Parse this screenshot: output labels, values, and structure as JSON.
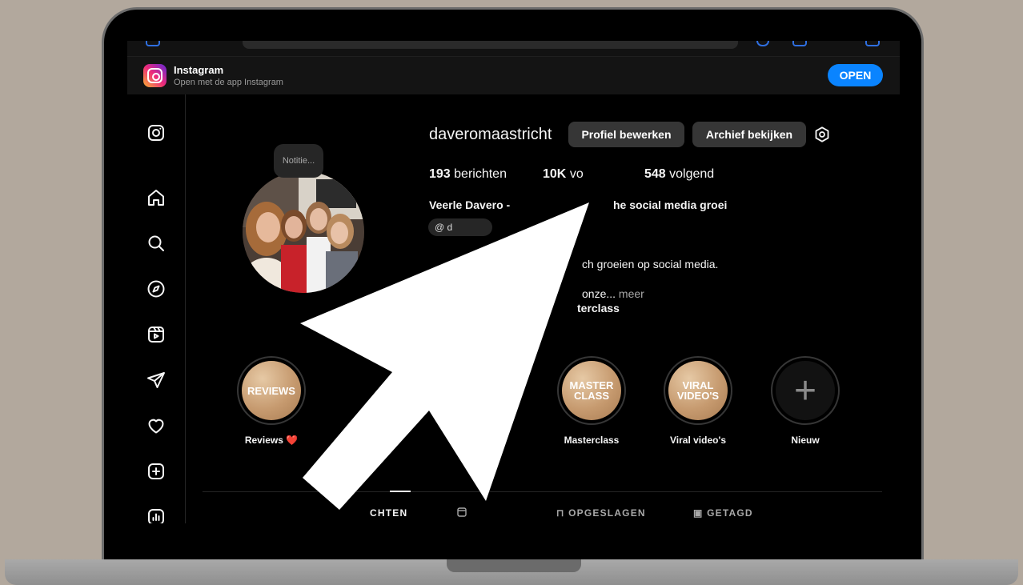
{
  "banner": {
    "app_name": "Instagram",
    "subtitle": "Open met de app Instagram",
    "open_label": "OPEN"
  },
  "profile": {
    "username": "daveromaastricht",
    "edit_label": "Profiel bewerken",
    "archive_label": "Archief bekijken",
    "note_text": "Notitie...",
    "stats": {
      "posts_count": "193",
      "posts_label": "berichten",
      "followers_count": "10K",
      "followers_label": "vo",
      "following_count": "548",
      "following_label": "volgend"
    },
    "bio": {
      "name_visible": "Veerle Davero - ",
      "name_tail": "he social media groei",
      "threads_handle": "d",
      "line1": "ch groeien op social media.",
      "line2": "onze...",
      "more": "meer",
      "line3": "terclass"
    }
  },
  "highlights": [
    {
      "inner": "REVIEWS",
      "label": "Reviews ❤️"
    },
    {
      "inner": "MASTER CLASS",
      "label": "Masterclass"
    },
    {
      "inner": "VIRAL VIDEO'S",
      "label": "Viral video's"
    },
    {
      "inner": "+",
      "label": "Nieuw"
    }
  ],
  "tabs": {
    "posts": "CHTEN",
    "saved": "OPGESLAGEN",
    "tagged": "GETAGD"
  },
  "colors": {
    "accent": "#0a84ff",
    "background": "#000000",
    "button": "#363636",
    "highlight_gold": "#c69a6f"
  }
}
